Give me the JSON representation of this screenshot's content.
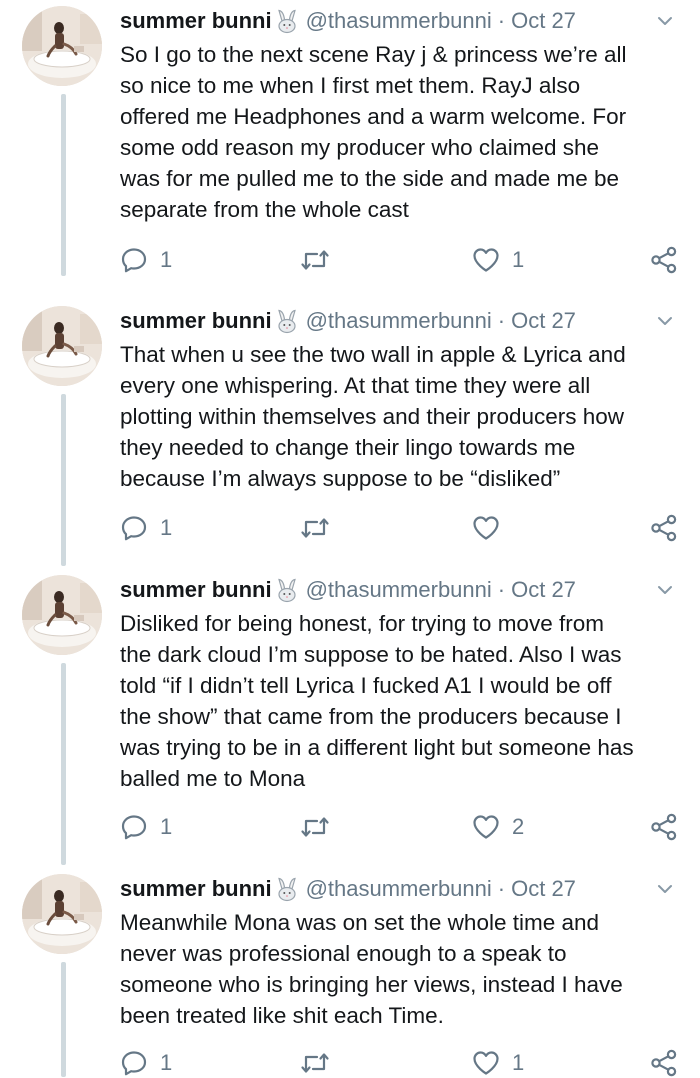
{
  "tweets": [
    {
      "name": "summer bunni",
      "handle": "@thasummerbunni",
      "separator": "·",
      "time": "Oct 27",
      "text": "So I go to the next scene Ray j & princess we’re all\nso nice to me when I first met them. RayJ also\noffered me Headphones and a warm welcome. For\nsome odd reason my producer who claimed she\nwas for me pulled me to the side and made me be\nseparate from the whole cast",
      "replies": "1",
      "retweets": "",
      "likes": "1"
    },
    {
      "name": "summer bunni",
      "handle": "@thasummerbunni",
      "separator": "·",
      "time": "Oct 27",
      "text": "That when u see the two wall in apple & Lyrica and\nevery one whispering. At that time they were all\nplotting within themselves and their producers how\nthey needed to change their lingo towards me\nbecause I’m always suppose to be “disliked”",
      "replies": "1",
      "retweets": "",
      "likes": ""
    },
    {
      "name": "summer bunni",
      "handle": "@thasummerbunni",
      "separator": "·",
      "time": "Oct 27",
      "text": "Disliked for being honest, for trying to move from\nthe dark cloud I’m suppose to be hated. Also I was\ntold “if I didn’t tell Lyrica I fucked A1 I would be off\nthe show” that came from the producers because I\nwas trying to be in a different light but someone has\nballed me to Mona",
      "replies": "1",
      "retweets": "",
      "likes": "2"
    },
    {
      "name": "summer bunni",
      "handle": "@thasummerbunni",
      "separator": "·",
      "time": "Oct 27",
      "text": "Meanwhile Mona was on set the whole time and\nnever was professional enough to a speak to\nsomeone who is bringing her views, instead I have\nbeen treated like shit each Time.",
      "replies": "1",
      "retweets": "",
      "likes": "1"
    }
  ],
  "icons": {
    "name_badge": "bunny-icon",
    "menu": "chevron-down-icon",
    "reply": "reply-icon",
    "retweet": "retweet-icon",
    "like": "heart-icon",
    "share": "share-icon"
  },
  "colors": {
    "text": "#14171a",
    "secondary": "#657786",
    "thread_line": "#cfd9de"
  }
}
